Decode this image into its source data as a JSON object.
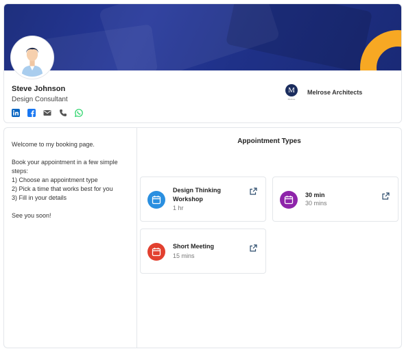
{
  "profile": {
    "name": "Steve Johnson",
    "title": "Design Consultant",
    "socials": [
      {
        "icon": "linkedin-icon",
        "color": "#0a66c2"
      },
      {
        "icon": "facebook-icon",
        "color": "#1877f2"
      },
      {
        "icon": "email-icon",
        "color": "#555555"
      },
      {
        "icon": "phone-icon",
        "color": "#555555"
      },
      {
        "icon": "whatsapp-icon",
        "color": "#25d366"
      }
    ]
  },
  "company": {
    "logo_letter": "M",
    "logo_subtext": "Melrose",
    "name": "Melrose Architects"
  },
  "welcome": {
    "line1": "Welcome to my booking page.",
    "line2": "Book your appointment in a few simple steps:",
    "step1": "1) Choose an appointment type",
    "step2": "2) Pick a time that works best for you",
    "step3": "3) Fill in your details",
    "closing": "See you soon!"
  },
  "appointments": {
    "heading": "Appointment Types",
    "items": [
      {
        "title": "Design Thinking Workshop",
        "duration": "1 hr",
        "color": "#2a8fe0",
        "icon": "calendar-icon"
      },
      {
        "title": "30 min",
        "duration": "30 mins",
        "color": "#8e24aa",
        "icon": "calendar-icon"
      },
      {
        "title": "Short Meeting",
        "duration": "15 mins",
        "color": "#e2402f",
        "icon": "calendar-icon"
      }
    ]
  },
  "colors": {
    "banner": "#1f3188",
    "accent_ring": "#f7a823"
  }
}
